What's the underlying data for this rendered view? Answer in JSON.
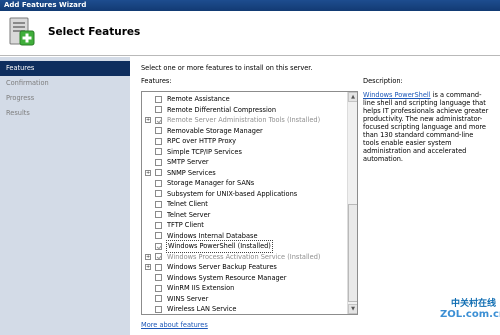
{
  "window": {
    "title": "Add Features Wizard"
  },
  "header": {
    "title": "Select Features",
    "icon": "server-features-icon"
  },
  "nav": [
    {
      "label": "Features",
      "state": "active"
    },
    {
      "label": "Confirmation",
      "state": "inactive"
    },
    {
      "label": "Progress",
      "state": "inactive"
    },
    {
      "label": "Results",
      "state": "inactive"
    }
  ],
  "main": {
    "instruction": "Select one or more features to install on this server.",
    "features_label": "Features:",
    "description_label": "Description:",
    "more_link": "More about features",
    "description": {
      "link": "Windows PowerShell",
      "text": " is a command-line shell and scripting language that helps IT professionals achieve greater productivity. The new administrator-focused scripting language and more than 130 standard command-line tools enable easier system administration and accelerated automation."
    }
  },
  "features": [
    {
      "label": "Remote Assistance",
      "checked": false,
      "expandable": false,
      "grey": false
    },
    {
      "label": "Remote Differential Compression",
      "checked": false,
      "expandable": false,
      "grey": false
    },
    {
      "label": "Remote Server Administration Tools  (Installed)",
      "checked": true,
      "expandable": true,
      "grey": true
    },
    {
      "label": "Removable Storage Manager",
      "checked": false,
      "expandable": false,
      "grey": false
    },
    {
      "label": "RPC over HTTP Proxy",
      "checked": false,
      "expandable": false,
      "grey": false
    },
    {
      "label": "Simple TCP/IP Services",
      "checked": false,
      "expandable": false,
      "grey": false
    },
    {
      "label": "SMTP Server",
      "checked": false,
      "expandable": false,
      "grey": false
    },
    {
      "label": "SNMP Services",
      "checked": false,
      "expandable": true,
      "grey": false
    },
    {
      "label": "Storage Manager for SANs",
      "checked": false,
      "expandable": false,
      "grey": false
    },
    {
      "label": "Subsystem for UNIX-based Applications",
      "checked": false,
      "expandable": false,
      "grey": false
    },
    {
      "label": "Telnet Client",
      "checked": false,
      "expandable": false,
      "grey": false
    },
    {
      "label": "Telnet Server",
      "checked": false,
      "expandable": false,
      "grey": false
    },
    {
      "label": "TFTP Client",
      "checked": false,
      "expandable": false,
      "grey": false
    },
    {
      "label": "Windows Internal Database",
      "checked": false,
      "expandable": false,
      "grey": false
    },
    {
      "label": "Windows PowerShell  (Installed)",
      "checked": true,
      "expandable": false,
      "grey": false,
      "selected": true
    },
    {
      "label": "Windows Process Activation Service  (Installed)",
      "checked": true,
      "expandable": true,
      "grey": true
    },
    {
      "label": "Windows Server Backup Features",
      "checked": false,
      "expandable": true,
      "grey": false
    },
    {
      "label": "Windows System Resource Manager",
      "checked": false,
      "expandable": false,
      "grey": false
    },
    {
      "label": "WinRM IIS Extension",
      "checked": false,
      "expandable": false,
      "grey": false
    },
    {
      "label": "WINS Server",
      "checked": false,
      "expandable": false,
      "grey": false
    },
    {
      "label": "Wireless LAN Service",
      "checked": false,
      "expandable": false,
      "grey": false
    }
  ],
  "watermark": {
    "line1": "中关村在线",
    "line2": "ZOL.com.cn"
  }
}
